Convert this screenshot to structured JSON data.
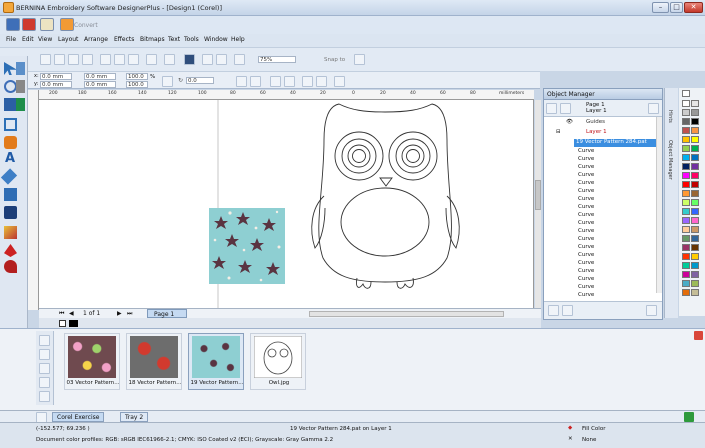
{
  "window": {
    "title": "BERNINA Embroidery Software DesignerPlus - [Design1 (Corel)]"
  },
  "quickbar": {
    "convert_label": "Convert"
  },
  "menu": [
    "File",
    "Edit",
    "View",
    "Layout",
    "Arrange",
    "Effects",
    "Bitmaps",
    "Text",
    "Tools",
    "Window",
    "Help"
  ],
  "toolbar": {
    "zoom_value": "75%",
    "snap_label": "Snap to"
  },
  "properties": {
    "x_value": "0.0 mm",
    "y_value": "0.0 mm",
    "w_value": "0.0 mm",
    "h_value": "0.0 mm",
    "scale_w": "100.0",
    "scale_h": "100.0",
    "pct_sign": "%",
    "angle_value": "0.0"
  },
  "ruler": {
    "units": "millimeters",
    "ticks": [
      "200",
      "180",
      "160",
      "140",
      "120",
      "100",
      "80",
      "60",
      "40",
      "20",
      "0",
      "20",
      "40",
      "60",
      "80"
    ]
  },
  "pagebar": {
    "page_count": "1 of 1",
    "page_tab": "Page 1"
  },
  "object_manager": {
    "title": "Object Manager",
    "page": "Page 1",
    "layer_top": "Layer 1",
    "guides": "Guides",
    "layer": "Layer 1",
    "selected": "19 Vector Pattern 284.pat",
    "curves": [
      "Curve",
      "Curve",
      "Curve",
      "Curve",
      "Curve",
      "Curve",
      "Curve",
      "Curve",
      "Curve",
      "Curve",
      "Curve",
      "Curve",
      "Curve",
      "Curve",
      "Curve",
      "Curve",
      "Curve",
      "Curve",
      "Curve",
      "Curve"
    ]
  },
  "docker_tabs": [
    "Hints",
    "Object Manager"
  ],
  "tray": {
    "items": [
      {
        "label": "03 Vector Pattern..."
      },
      {
        "label": "18 Vector Pattern..."
      },
      {
        "label": "19 Vector Pattern..."
      },
      {
        "label": "Owl.jpg"
      }
    ],
    "tabs": [
      "Corel Exercise",
      "Tray 2"
    ]
  },
  "status": {
    "coords": "(-152.577; 69.236 )",
    "selection": "19 Vector Pattern 284.pat on Layer 1",
    "profiles": "Document color profiles: RGB: sRGB IEC61966-2.1; CMYK: ISO Coated v2 (ECI); Grayscale: Gray Gamma 2.2",
    "fill_label": "Fill Color",
    "outline_label": "None"
  },
  "colors": {
    "accent": "#3b8ee0",
    "pattern_bg": "#8ecfd2",
    "star": "#5a3441"
  }
}
